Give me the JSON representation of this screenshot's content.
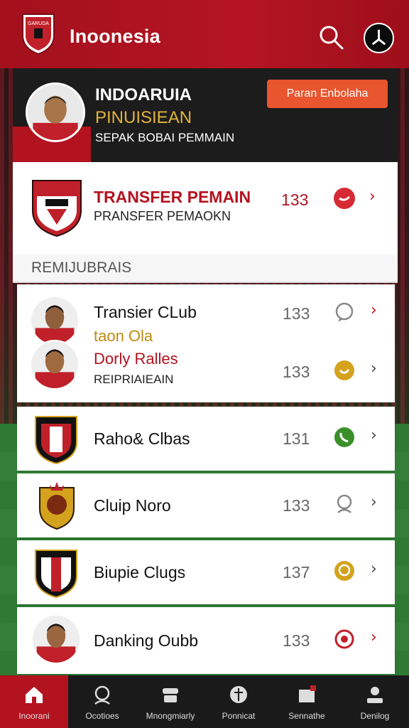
{
  "header": {
    "title": "Inoonesia",
    "logo_text": "GARUDA"
  },
  "hero": {
    "name": "INDOARUIA",
    "subtitle": "PINUISIEAN",
    "caption": "SEPAK BOBAI PEMMAIN",
    "button_label": "Paran Enbolaha"
  },
  "transfer_card": {
    "title": "TRANSFER PEMAIN",
    "subtitle": "PRANSFER PEMAOKN",
    "count": "133"
  },
  "section_label": "REMIJUBRAIS",
  "rows": [
    {
      "title": "Transier CLub",
      "count": "133",
      "icon": "chat-icon",
      "color": "#888888"
    },
    {
      "title": "taon Ola",
      "highlight": "Dorly Ralles",
      "subtitle": "REIPRIAIEAIN",
      "count": "133",
      "icon": "chat-icon",
      "color": "#d4a21c"
    },
    {
      "title": "Raho& Clbas",
      "count": "131",
      "icon": "phone-icon",
      "color": "#3a8f2a"
    },
    {
      "title": "Cluip Noro",
      "count": "133",
      "icon": "person-icon",
      "color": "#888888"
    },
    {
      "title": "Biupie Clugs",
      "count": "137",
      "icon": "chat-icon",
      "color": "#d4a21c"
    },
    {
      "title": "Danking Oubb",
      "count": "133",
      "icon": "target-icon",
      "color": "#c0202a"
    }
  ],
  "nav": [
    {
      "label": "Inoorani",
      "icon": "home-icon"
    },
    {
      "label": "Ocotioes",
      "icon": "user-circle-icon"
    },
    {
      "label": "Mnongmiarly",
      "icon": "helmet-icon"
    },
    {
      "label": "Ponnicat",
      "icon": "ball-icon"
    },
    {
      "label": "Sennathe",
      "icon": "bag-icon"
    },
    {
      "label": "Denilog",
      "icon": "profile-icon"
    }
  ],
  "colors": {
    "brand_red": "#b3121f",
    "accent_orange": "#e8552e",
    "gold": "#e0b33b"
  }
}
